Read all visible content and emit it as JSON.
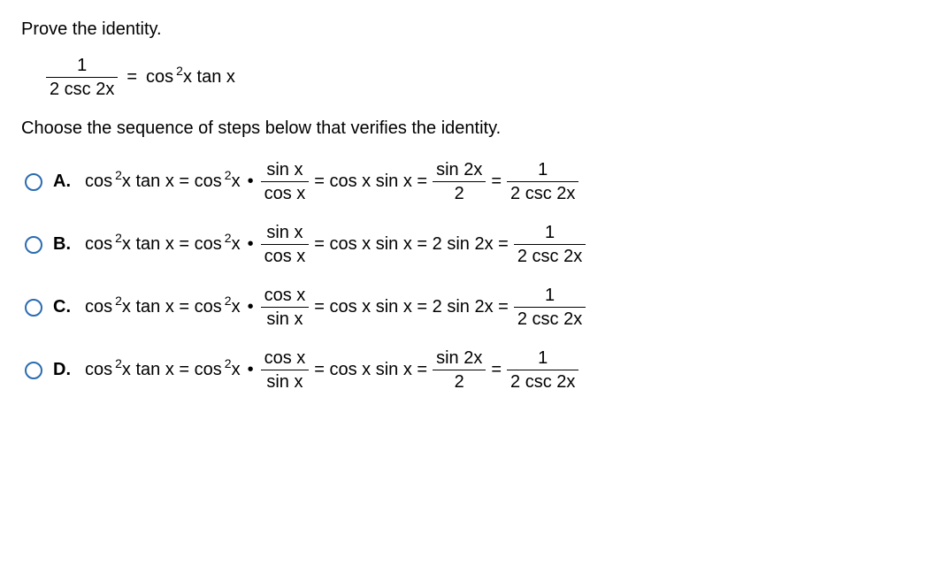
{
  "prompt": "Prove the identity.",
  "identity": {
    "lhs_num": "1",
    "lhs_den": "2 csc 2x",
    "equals": "=",
    "rhs_pre": "cos",
    "rhs_exp": "2",
    "rhs_post": "x tan x"
  },
  "choose": "Choose the sequence of steps below that verifies the identity.",
  "options": [
    {
      "label": "A.",
      "s1": {
        "pre": "cos",
        "exp": "2",
        "post": "x tan x = cos",
        "exp2": "2",
        "post2": "x",
        "dot": "•"
      },
      "f1": {
        "num": "sin x",
        "den": "cos x"
      },
      "eq1": "= cos x sin x =",
      "f2": {
        "num": "sin 2x",
        "den": "2"
      },
      "eq2": "=",
      "f3": {
        "num": "1",
        "den": "2 csc 2x"
      }
    },
    {
      "label": "B.",
      "s1": {
        "pre": "cos",
        "exp": "2",
        "post": "x tan x = cos",
        "exp2": "2",
        "post2": "x",
        "dot": "•"
      },
      "f1": {
        "num": "sin x",
        "den": "cos x"
      },
      "eq1": "= cos x sin x = 2 sin 2x =",
      "f2": null,
      "eq2": "",
      "f3": {
        "num": "1",
        "den": "2 csc 2x"
      }
    },
    {
      "label": "C.",
      "s1": {
        "pre": "cos",
        "exp": "2",
        "post": "x tan x = cos",
        "exp2": "2",
        "post2": "x",
        "dot": "•"
      },
      "f1": {
        "num": "cos x",
        "den": "sin x"
      },
      "eq1": "= cos x sin x = 2 sin 2x =",
      "f2": null,
      "eq2": "",
      "f3": {
        "num": "1",
        "den": "2 csc 2x"
      }
    },
    {
      "label": "D.",
      "s1": {
        "pre": "cos",
        "exp": "2",
        "post": "x tan x = cos",
        "exp2": "2",
        "post2": "x",
        "dot": "•"
      },
      "f1": {
        "num": "cos x",
        "den": "sin x"
      },
      "eq1": "= cos x sin x =",
      "f2": {
        "num": "sin 2x",
        "den": "2"
      },
      "eq2": "=",
      "f3": {
        "num": "1",
        "den": "2 csc 2x"
      }
    }
  ]
}
